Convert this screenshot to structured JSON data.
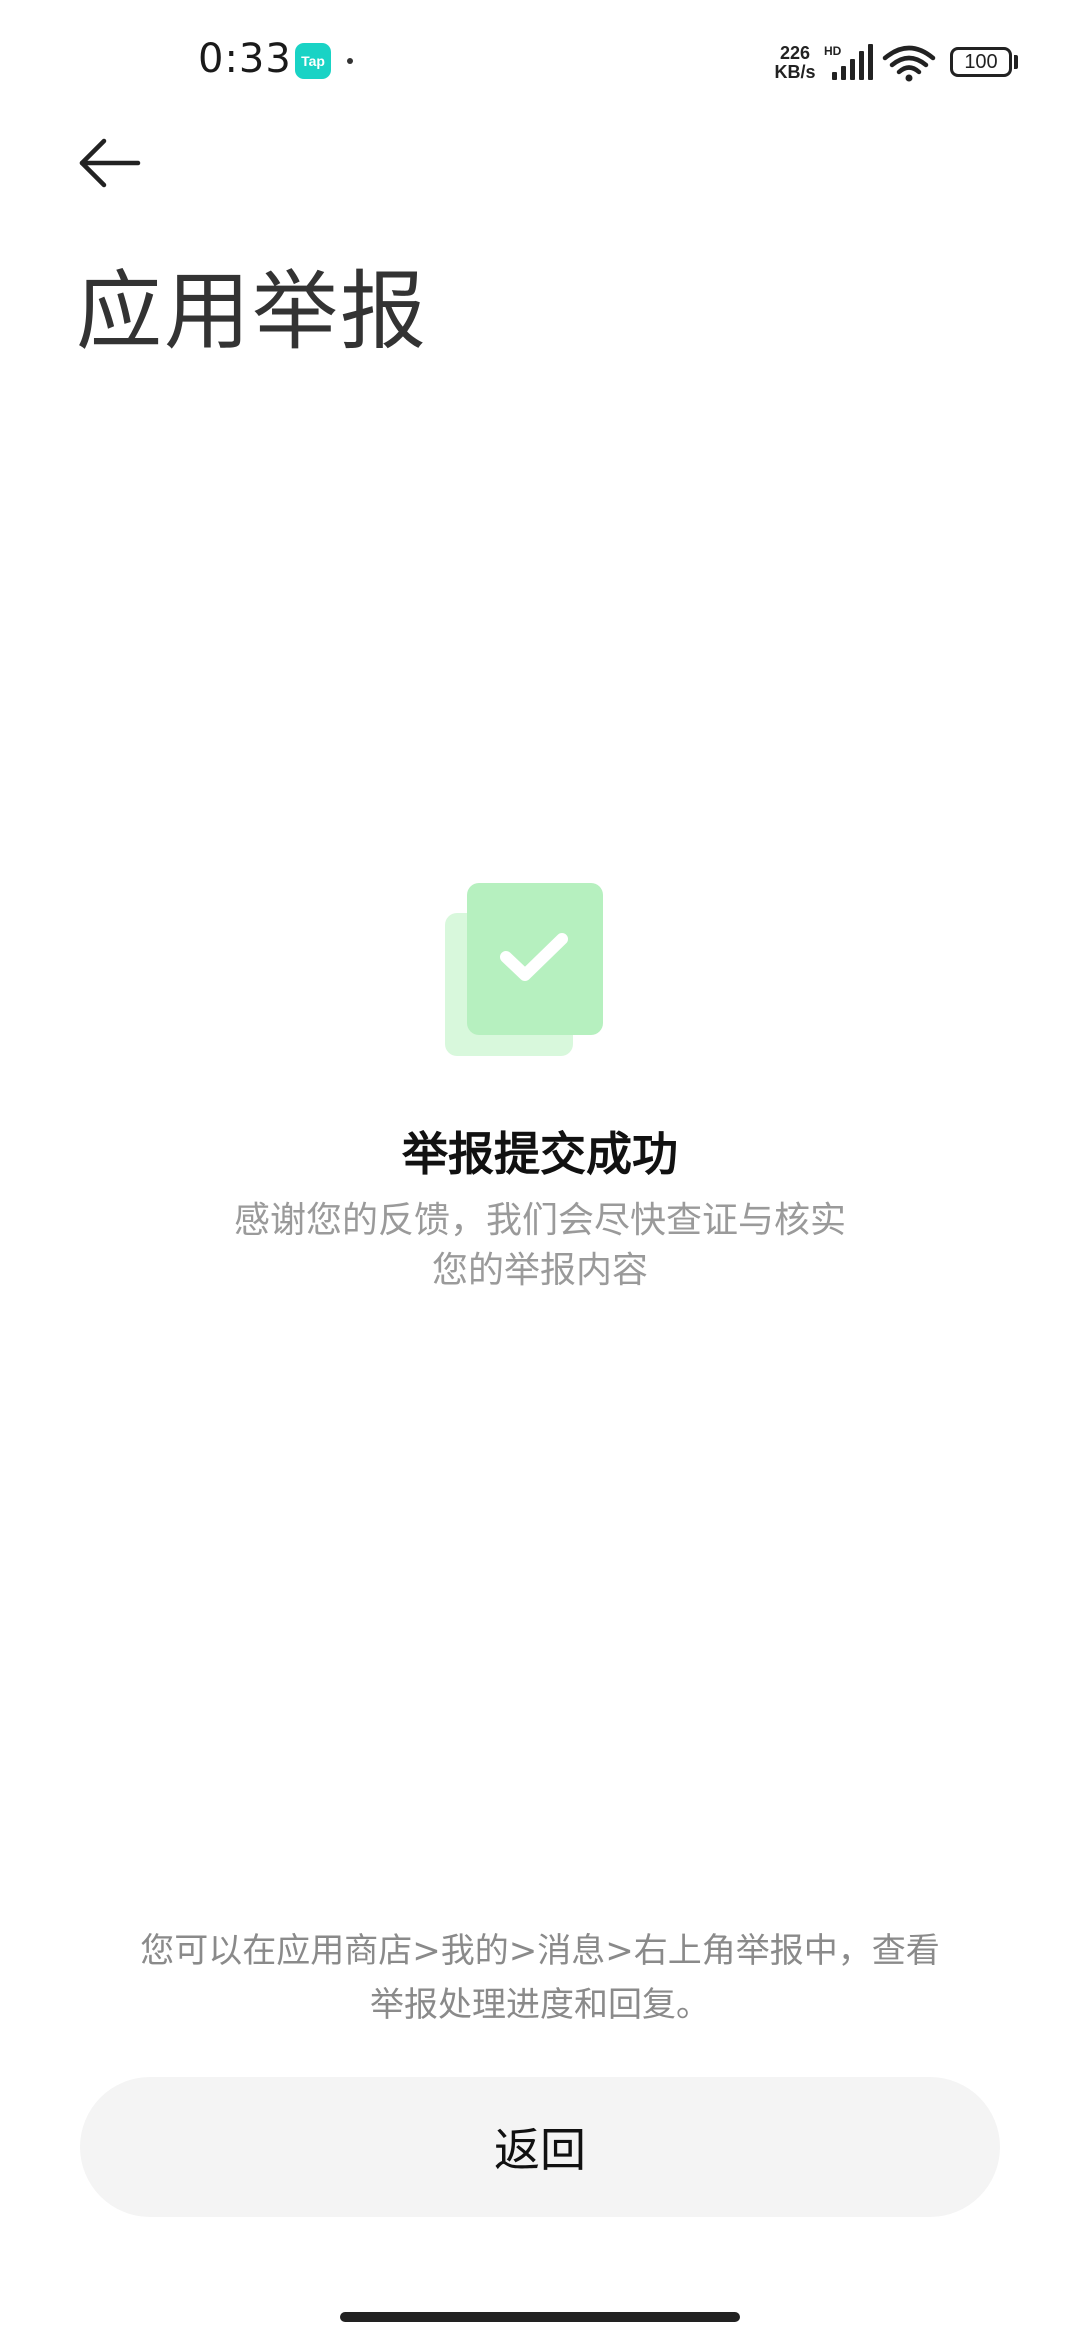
{
  "status_bar": {
    "time": "0:33",
    "app_badge": "Tap",
    "net_speed_value": "226",
    "net_speed_unit": "KB/s",
    "network_label": "HD",
    "battery": "100"
  },
  "header": {
    "title": "应用举报"
  },
  "result": {
    "title": "举报提交成功",
    "description": "感谢您的反馈，我们会尽快查证与核实您的举报内容"
  },
  "footer": {
    "tip": "您可以在应用商店>我的>消息>右上角举报中，查看举报处理进度和回复。",
    "return_label": "返回"
  },
  "colors": {
    "tap_badge": "#19d3c5",
    "illustration_front": "#b6f0bf",
    "illustration_back": "#d8f8dc",
    "button_background": "#f4f4f4"
  },
  "icons": {
    "back": "arrow-left-icon",
    "success": "check-icon",
    "signal": "signal-icon",
    "wifi": "wifi-icon",
    "battery": "battery-icon"
  }
}
